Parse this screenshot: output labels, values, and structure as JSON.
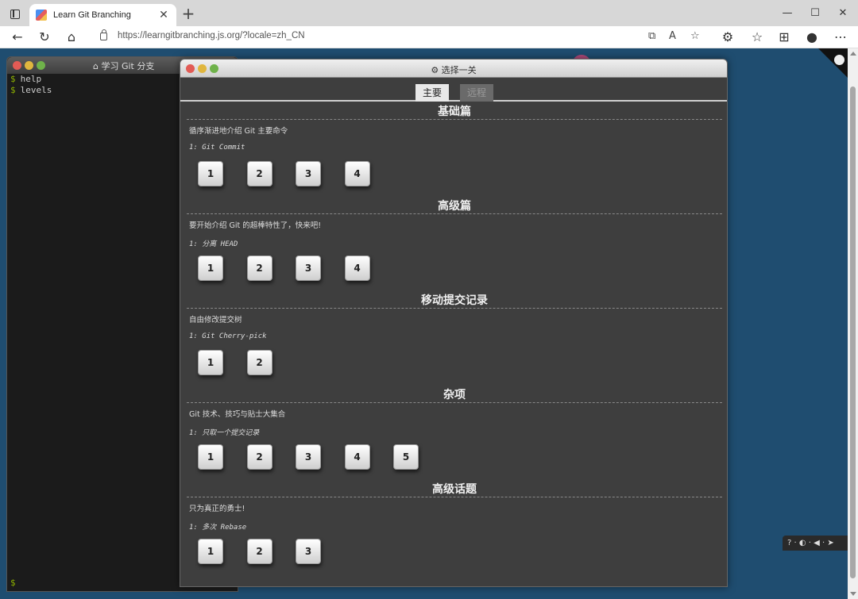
{
  "browser": {
    "tab_title": "Learn Git Branching",
    "tab_close": "✕",
    "new_tab": "+",
    "url": "https://learngitbranching.js.org/?locale=zh_CN",
    "win_min": "—",
    "win_max": "☐",
    "win_close": "✕"
  },
  "terminal": {
    "title": "学习 Git 分支",
    "lines": [
      {
        "prompt": "$",
        "cmd": "help"
      },
      {
        "prompt": "$",
        "cmd": "levels"
      }
    ],
    "cursor_prompt": "$"
  },
  "modal": {
    "title": "选择一关",
    "tabs": [
      "主要",
      "远程"
    ],
    "sections": [
      {
        "title": "基础篇",
        "desc": "循序渐进地介绍 Git 主要命令",
        "sub": "1: Git Commit",
        "levels": [
          "1",
          "2",
          "3",
          "4"
        ]
      },
      {
        "title": "高级篇",
        "desc": "要开始介绍 Git 的超棒特性了，快来吧!",
        "sub": "1: 分离 HEAD",
        "levels": [
          "1",
          "2",
          "3",
          "4"
        ]
      },
      {
        "title": "移动提交记录",
        "desc": "自由修改提交树",
        "sub": "1: Git Cherry-pick",
        "levels": [
          "1",
          "2"
        ]
      },
      {
        "title": "杂项",
        "desc": "Git 技术、技巧与贴士大集合",
        "sub": "1: 只取一个提交记录",
        "levels": [
          "1",
          "2",
          "3",
          "4",
          "5"
        ]
      },
      {
        "title": "高级话题",
        "desc": "只为真正的勇士!",
        "sub": "1: 多次 Rebase",
        "levels": [
          "1",
          "2",
          "3"
        ]
      }
    ]
  },
  "widget": {
    "text": "? · ◐ · ◀ · ➤"
  },
  "colors": {
    "page_bg": "#1f4d70",
    "modal_bg": "#3e3e3e",
    "terminal_bg": "#1b1b1b",
    "prompt_green": "#8cb000"
  }
}
